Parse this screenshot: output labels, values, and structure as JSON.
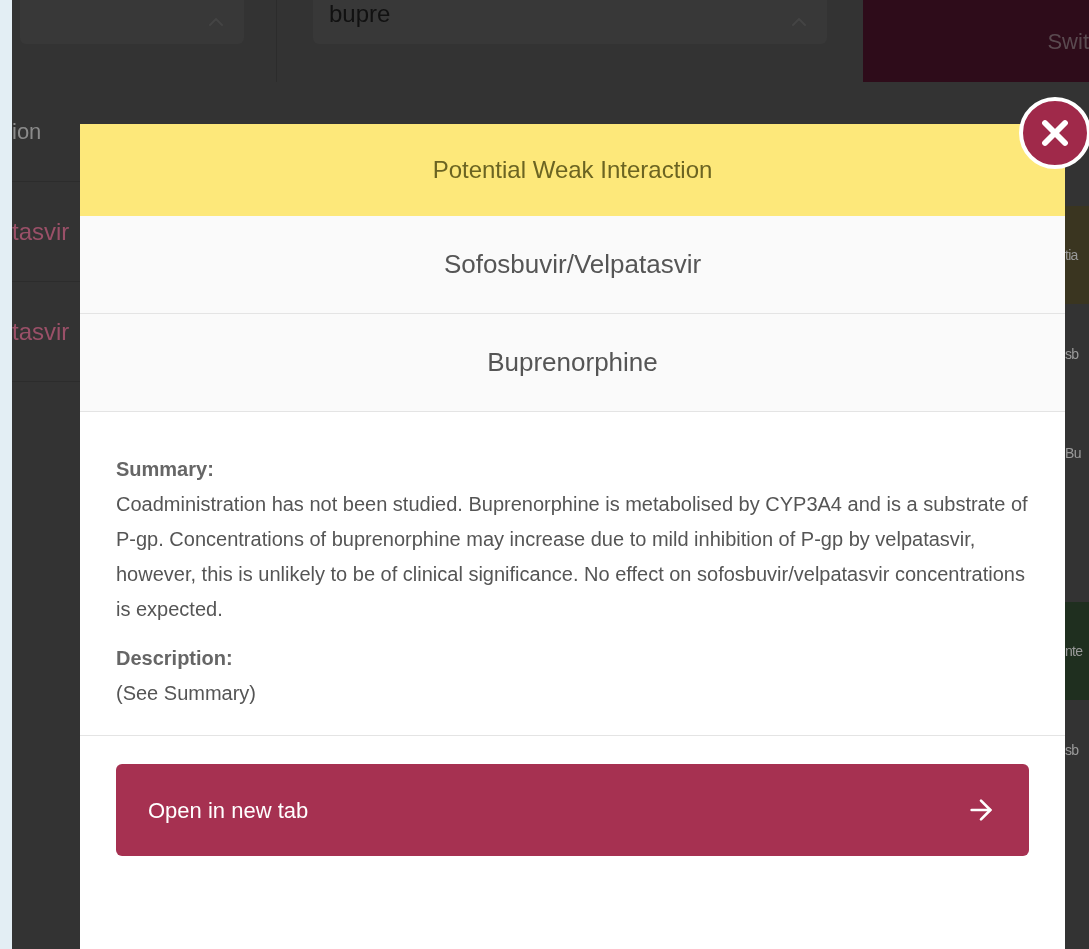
{
  "background": {
    "search_value": "bupre",
    "switch_button": "Swit",
    "column_label": "ion",
    "left_rows": [
      "tasvir",
      "tasvir"
    ],
    "right_rows": [
      {
        "text": "tia",
        "kind": "weak"
      },
      {
        "text": "sb",
        "kind": "plain"
      },
      {
        "text": "Bu",
        "kind": "plain"
      },
      {
        "kind": "plain"
      },
      {
        "text": "nte",
        "kind": "none"
      },
      {
        "text": "sb",
        "kind": "plain"
      }
    ]
  },
  "modal": {
    "severity": "Potential Weak Interaction",
    "drugs": [
      "Sofosbuvir/Velpatasvir",
      "Buprenorphine"
    ],
    "sections": [
      {
        "heading": "Summary:",
        "text": "Coadministration has not been studied. Buprenorphine is metabolised by CYP3A4 and is a substrate of P-gp. Concentrations of buprenorphine may increase due to mild inhibition of P-gp by velpatasvir, however, this is unlikely to be of clinical significance. No effect on sofosbuvir/velpatasvir concentrations is expected."
      },
      {
        "heading": "Description:",
        "text": "(See Summary)"
      }
    ],
    "open_button": "Open in new tab"
  }
}
